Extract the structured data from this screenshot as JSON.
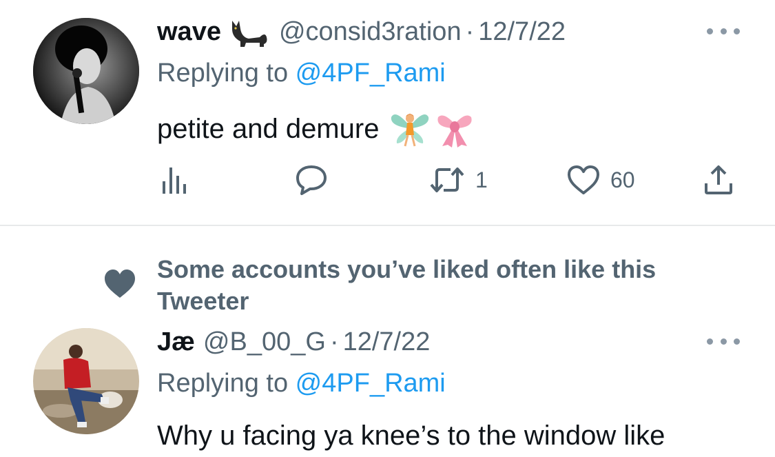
{
  "tweets": [
    {
      "display_name": "wave",
      "handle": "@consid3ration",
      "separator": "·",
      "date": "12/7/22",
      "replying_prefix": "Replying to ",
      "replying_to": "@4PF_Rami",
      "text": "petite and demure",
      "actions": {
        "views_count": "",
        "reply_count": "",
        "retweet_count": "1",
        "like_count": "60"
      },
      "name_emoji": "black-cat-emoji",
      "text_emojis": [
        "fairy-emoji",
        "ribbon-emoji"
      ]
    },
    {
      "social_context": "Some accounts you’ve liked often like this Tweeter",
      "display_name": "Jæ",
      "handle": "@B_00_G",
      "separator": "·",
      "date": "12/7/22",
      "replying_prefix": "Replying to ",
      "replying_to": "@4PF_Rami",
      "text": "Why u facing ya knee’s to the window like"
    }
  ],
  "colors": {
    "primary_text": "#0f1419",
    "secondary_text": "#536471",
    "link": "#1d9bf0",
    "divider": "#e7e9ea"
  }
}
